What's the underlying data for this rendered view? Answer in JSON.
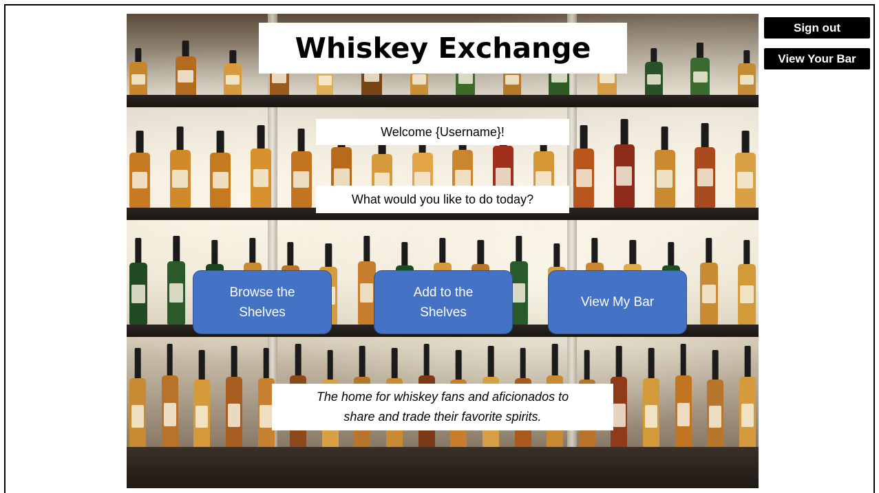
{
  "header": {
    "title": "Whiskey Exchange",
    "sign_out_label": "Sign out",
    "view_your_bar_label": "View Your Bar"
  },
  "main": {
    "welcome_text": "Welcome {Username}!",
    "prompt_text": "What would you like to do today?",
    "actions": [
      {
        "line1": "Browse the",
        "line2": "Shelves"
      },
      {
        "line1": "Add to the",
        "line2": "Shelves"
      },
      {
        "line1": "View My Bar",
        "line2": ""
      }
    ],
    "tagline_line1": "The home for whiskey fans and aficionados to",
    "tagline_line2": "share and trade their favorite spirits."
  },
  "theme": {
    "button_blue": "#4472c4",
    "button_border": "#2f528f",
    "top_button_bg": "#000000"
  }
}
